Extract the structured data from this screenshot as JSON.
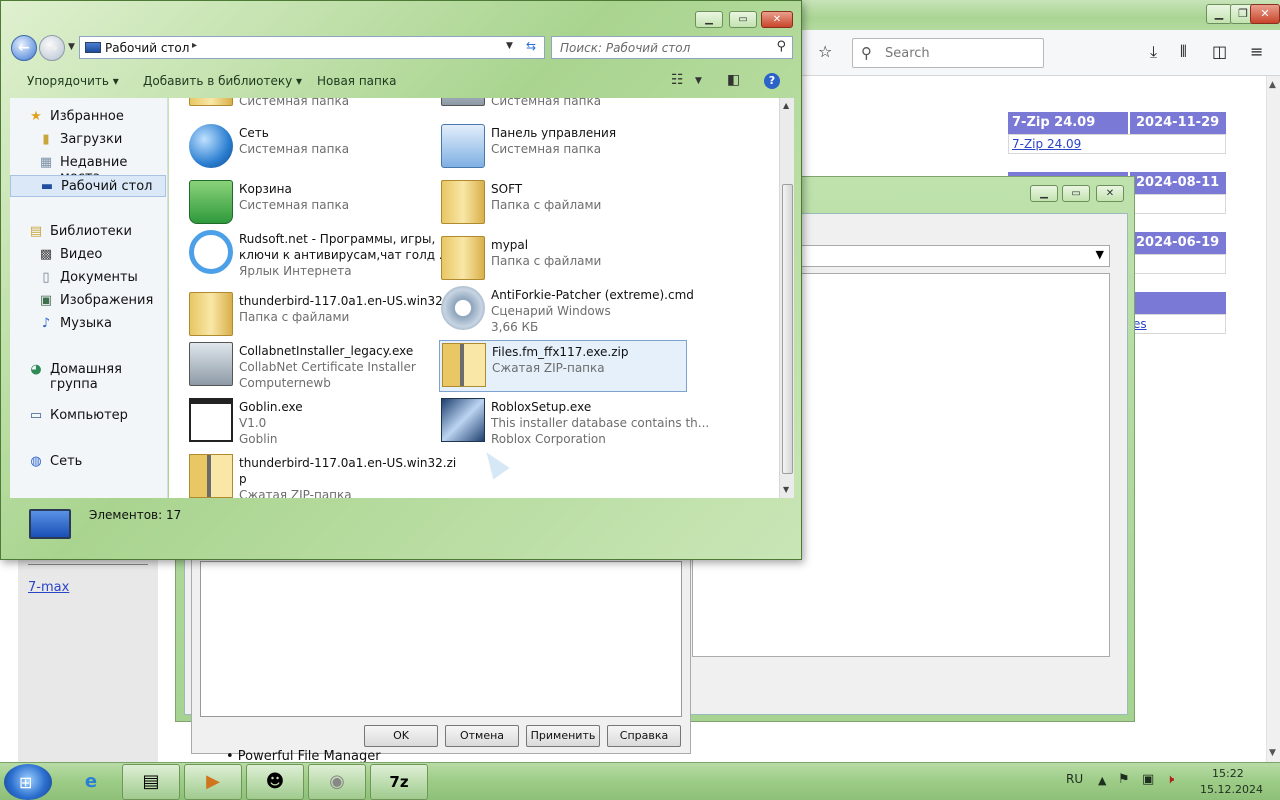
{
  "browser": {
    "search_placeholder": "Search",
    "versions": [
      {
        "name": "7-Zip 24.09",
        "date": "2024-11-29",
        "link": "7-Zip 24.09"
      },
      {
        "name": "",
        "date": "2024-08-11",
        "link": ""
      },
      {
        "name": "",
        "date": "2024-06-19",
        "link": ""
      },
      {
        "name": "",
        "date": "",
        "link": "es"
      }
    ],
    "sidebar_link": "7-max"
  },
  "props_dialog": {
    "ok": "OK",
    "cancel": "Отмена",
    "apply": "Применить",
    "help": "Справка",
    "stray_text": "• Powerful File Manager"
  },
  "explorer": {
    "address": "Рабочий стол",
    "search_placeholder": "Поиск: Рабочий стол",
    "commands": {
      "organize": "Упорядочить ▾",
      "add_to_library": "Добавить в библиотеку ▾",
      "new_folder": "Новая папка"
    },
    "nav": [
      {
        "label": "Избранное",
        "icon": "star-icon"
      },
      {
        "label": "Загрузки",
        "icon": "downloads-icon"
      },
      {
        "label": "Недавние места",
        "icon": "recent-icon"
      },
      {
        "label": "Рабочий стол",
        "icon": "desktop-icon",
        "selected": true
      },
      {
        "label": "Библиотеки",
        "icon": "libraries-icon"
      },
      {
        "label": "Видео",
        "icon": "video-icon"
      },
      {
        "label": "Документы",
        "icon": "documents-icon"
      },
      {
        "label": "Изображения",
        "icon": "pictures-icon"
      },
      {
        "label": "Музыка",
        "icon": "music-icon"
      },
      {
        "label": "Домашняя группа",
        "icon": "homegroup-icon"
      },
      {
        "label": "Компьютер",
        "icon": "computer-icon"
      },
      {
        "label": "Сеть",
        "icon": "network-icon"
      }
    ],
    "files": [
      {
        "name": "Системная папка",
        "line2": "",
        "line3": "",
        "icon": "folder-icon"
      },
      {
        "name": "Системная папка",
        "line2": "",
        "line3": "",
        "icon": "folder-icon"
      },
      {
        "name": "Сеть",
        "line2": "Системная папка",
        "line3": "",
        "icon": "network-globe-icon"
      },
      {
        "name": "Панель управления",
        "line2": "Системная папка",
        "line3": "",
        "icon": "control-panel-icon"
      },
      {
        "name": "Корзина",
        "line2": "Системная папка",
        "line3": "",
        "icon": "recycle-bin-icon"
      },
      {
        "name": "SOFT",
        "line2": "Папка с файлами",
        "line3": "",
        "icon": "folder-icon"
      },
      {
        "name": "Rudsoft.net - Программы, игры,",
        "line2": "ключи к антивирусам,чат голд ...",
        "line3": "Ярлык Интернета",
        "icon": "ie-shortcut-icon"
      },
      {
        "name": "mypal",
        "line2": "Папка с файлами",
        "line3": "",
        "icon": "folder-icon"
      },
      {
        "name": "thunderbird-117.0a1.en-US.win32",
        "line2": "Папка с файлами",
        "line3": "",
        "icon": "folder-icon"
      },
      {
        "name": "AntiForkie-Patcher (extreme).cmd",
        "line2": "Сценарий Windows",
        "line3": "3,66 КБ",
        "icon": "script-gear-icon"
      },
      {
        "name": "CollabnetInstaller_legacy.exe",
        "line2": "CollabNet Certificate Installer",
        "line3": "Computernewb",
        "icon": "installer-pc-icon"
      },
      {
        "name": "Files.fm_ffx117.exe.zip",
        "line2": "Сжатая ZIP-папка",
        "line3": "",
        "icon": "zip-folder-icon",
        "selected": true
      },
      {
        "name": "Goblin.exe",
        "line2": "V1.0",
        "line3": "Goblin",
        "icon": "app-window-icon"
      },
      {
        "name": "RobloxSetup.exe",
        "line2": "This installer database contains th...",
        "line3": "Roblox Corporation",
        "icon": "roblox-icon"
      },
      {
        "name": "thunderbird-117.0a1.en-US.win32.zi",
        "line2": "p",
        "line3": "Сжатая ZIP-папка",
        "icon": "zip-folder-icon"
      }
    ],
    "status": "Элементов: 17"
  },
  "taskbar": {
    "language": "RU",
    "time": "15:22",
    "date": "15.12.2024",
    "apps": [
      {
        "name": "internet-explorer-icon",
        "glyph": "e"
      },
      {
        "name": "file-explorer-icon",
        "glyph": "▤"
      },
      {
        "name": "media-player-icon",
        "glyph": "▶"
      },
      {
        "name": "raccoon-app-icon",
        "glyph": "☻"
      },
      {
        "name": "disc-app-icon",
        "glyph": "◉"
      },
      {
        "name": "7zip-icon",
        "glyph": "7z"
      }
    ]
  }
}
